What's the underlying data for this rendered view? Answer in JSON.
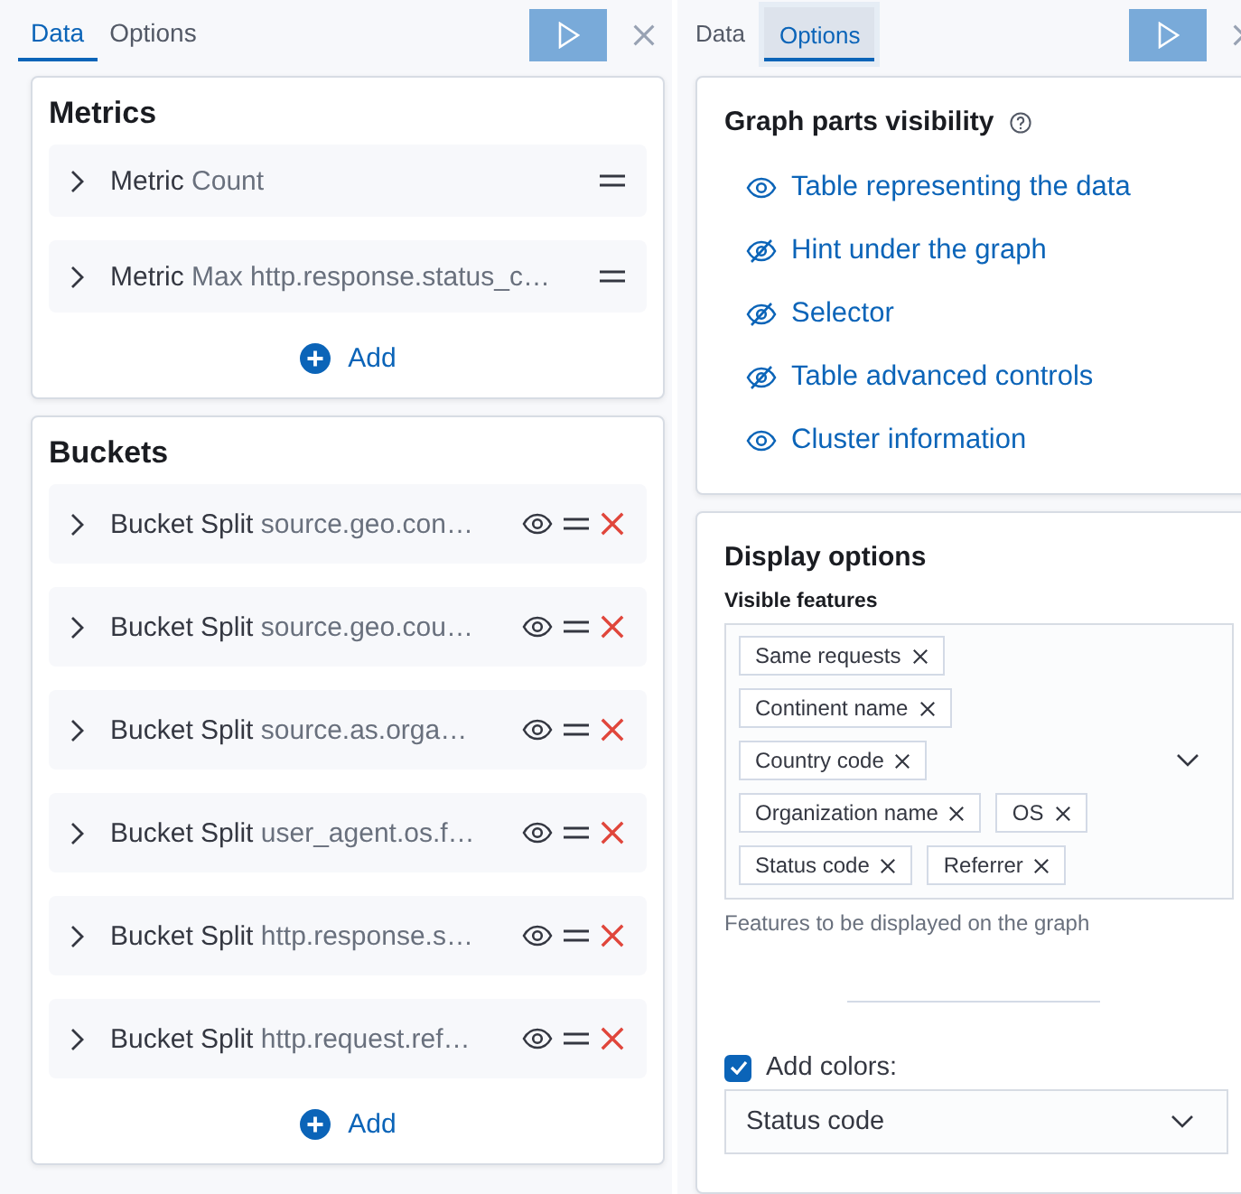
{
  "left_panel": {
    "tabs": [
      {
        "label": "Data",
        "selected": true
      },
      {
        "label": "Options",
        "selected": false
      }
    ],
    "metrics": {
      "title": "Metrics",
      "rows": [
        {
          "label": "Metric",
          "value": "Count"
        },
        {
          "label": "Metric",
          "value": "Max http.response.status_c…"
        }
      ],
      "add": "Add"
    },
    "buckets": {
      "title": "Buckets",
      "rows": [
        {
          "label": "Bucket Split",
          "value": "source.geo.con…"
        },
        {
          "label": "Bucket Split",
          "value": "source.geo.cou…"
        },
        {
          "label": "Bucket Split",
          "value": "source.as.orga…"
        },
        {
          "label": "Bucket Split",
          "value": "user_agent.os.f…"
        },
        {
          "label": "Bucket Split",
          "value": "http.response.s…"
        },
        {
          "label": "Bucket Split",
          "value": "http.request.ref…"
        }
      ],
      "add": "Add"
    }
  },
  "right_panel": {
    "tabs": [
      {
        "label": "Data",
        "selected": false
      },
      {
        "label": "Options",
        "selected": true
      }
    ],
    "graph_parts": {
      "title": "Graph parts visibility",
      "items": [
        {
          "label": "Table representing the data",
          "visible": true
        },
        {
          "label": "Hint under the graph",
          "visible": false
        },
        {
          "label": "Selector",
          "visible": false
        },
        {
          "label": "Table advanced controls",
          "visible": false
        },
        {
          "label": "Cluster information",
          "visible": true
        }
      ]
    },
    "display_options": {
      "title": "Display options",
      "field_label": "Visible features",
      "chips": [
        [
          "Same requests"
        ],
        [
          "Continent name"
        ],
        [
          "Country code"
        ],
        [
          "Organization name",
          "OS"
        ],
        [
          "Status code",
          "Referrer"
        ]
      ],
      "help_text": "Features to be displayed on the graph",
      "add_colors": {
        "label": "Add colors:",
        "checked": true
      },
      "color_select": {
        "value": "Status code"
      }
    }
  }
}
